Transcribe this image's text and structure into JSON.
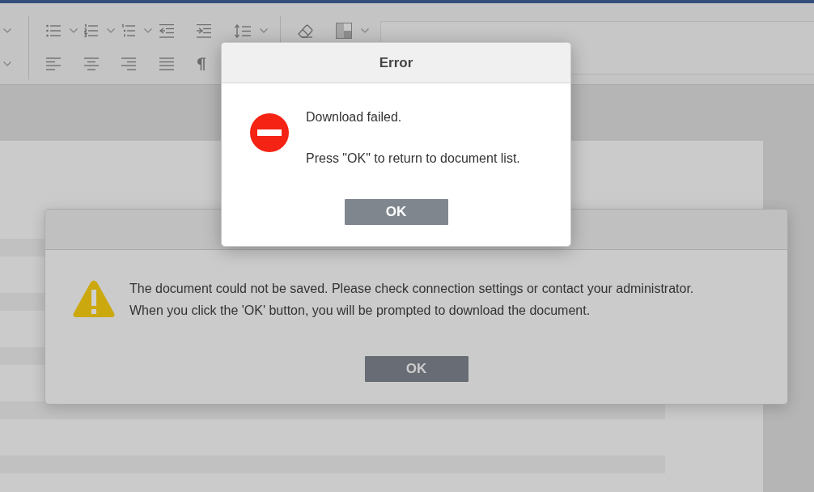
{
  "warning_dialog": {
    "message_lines": [
      "The document could not be saved. Please check connection settings or contact your administrator.",
      "When you click the 'OK' button, you will be prompted to download the document."
    ],
    "buttons": [
      {
        "label": "OK"
      }
    ]
  },
  "error_dialog": {
    "title": "Error",
    "messages": [
      "Download failed.",
      "Press \"OK\" to return to document list."
    ],
    "buttons": [
      {
        "label": "OK"
      }
    ]
  }
}
